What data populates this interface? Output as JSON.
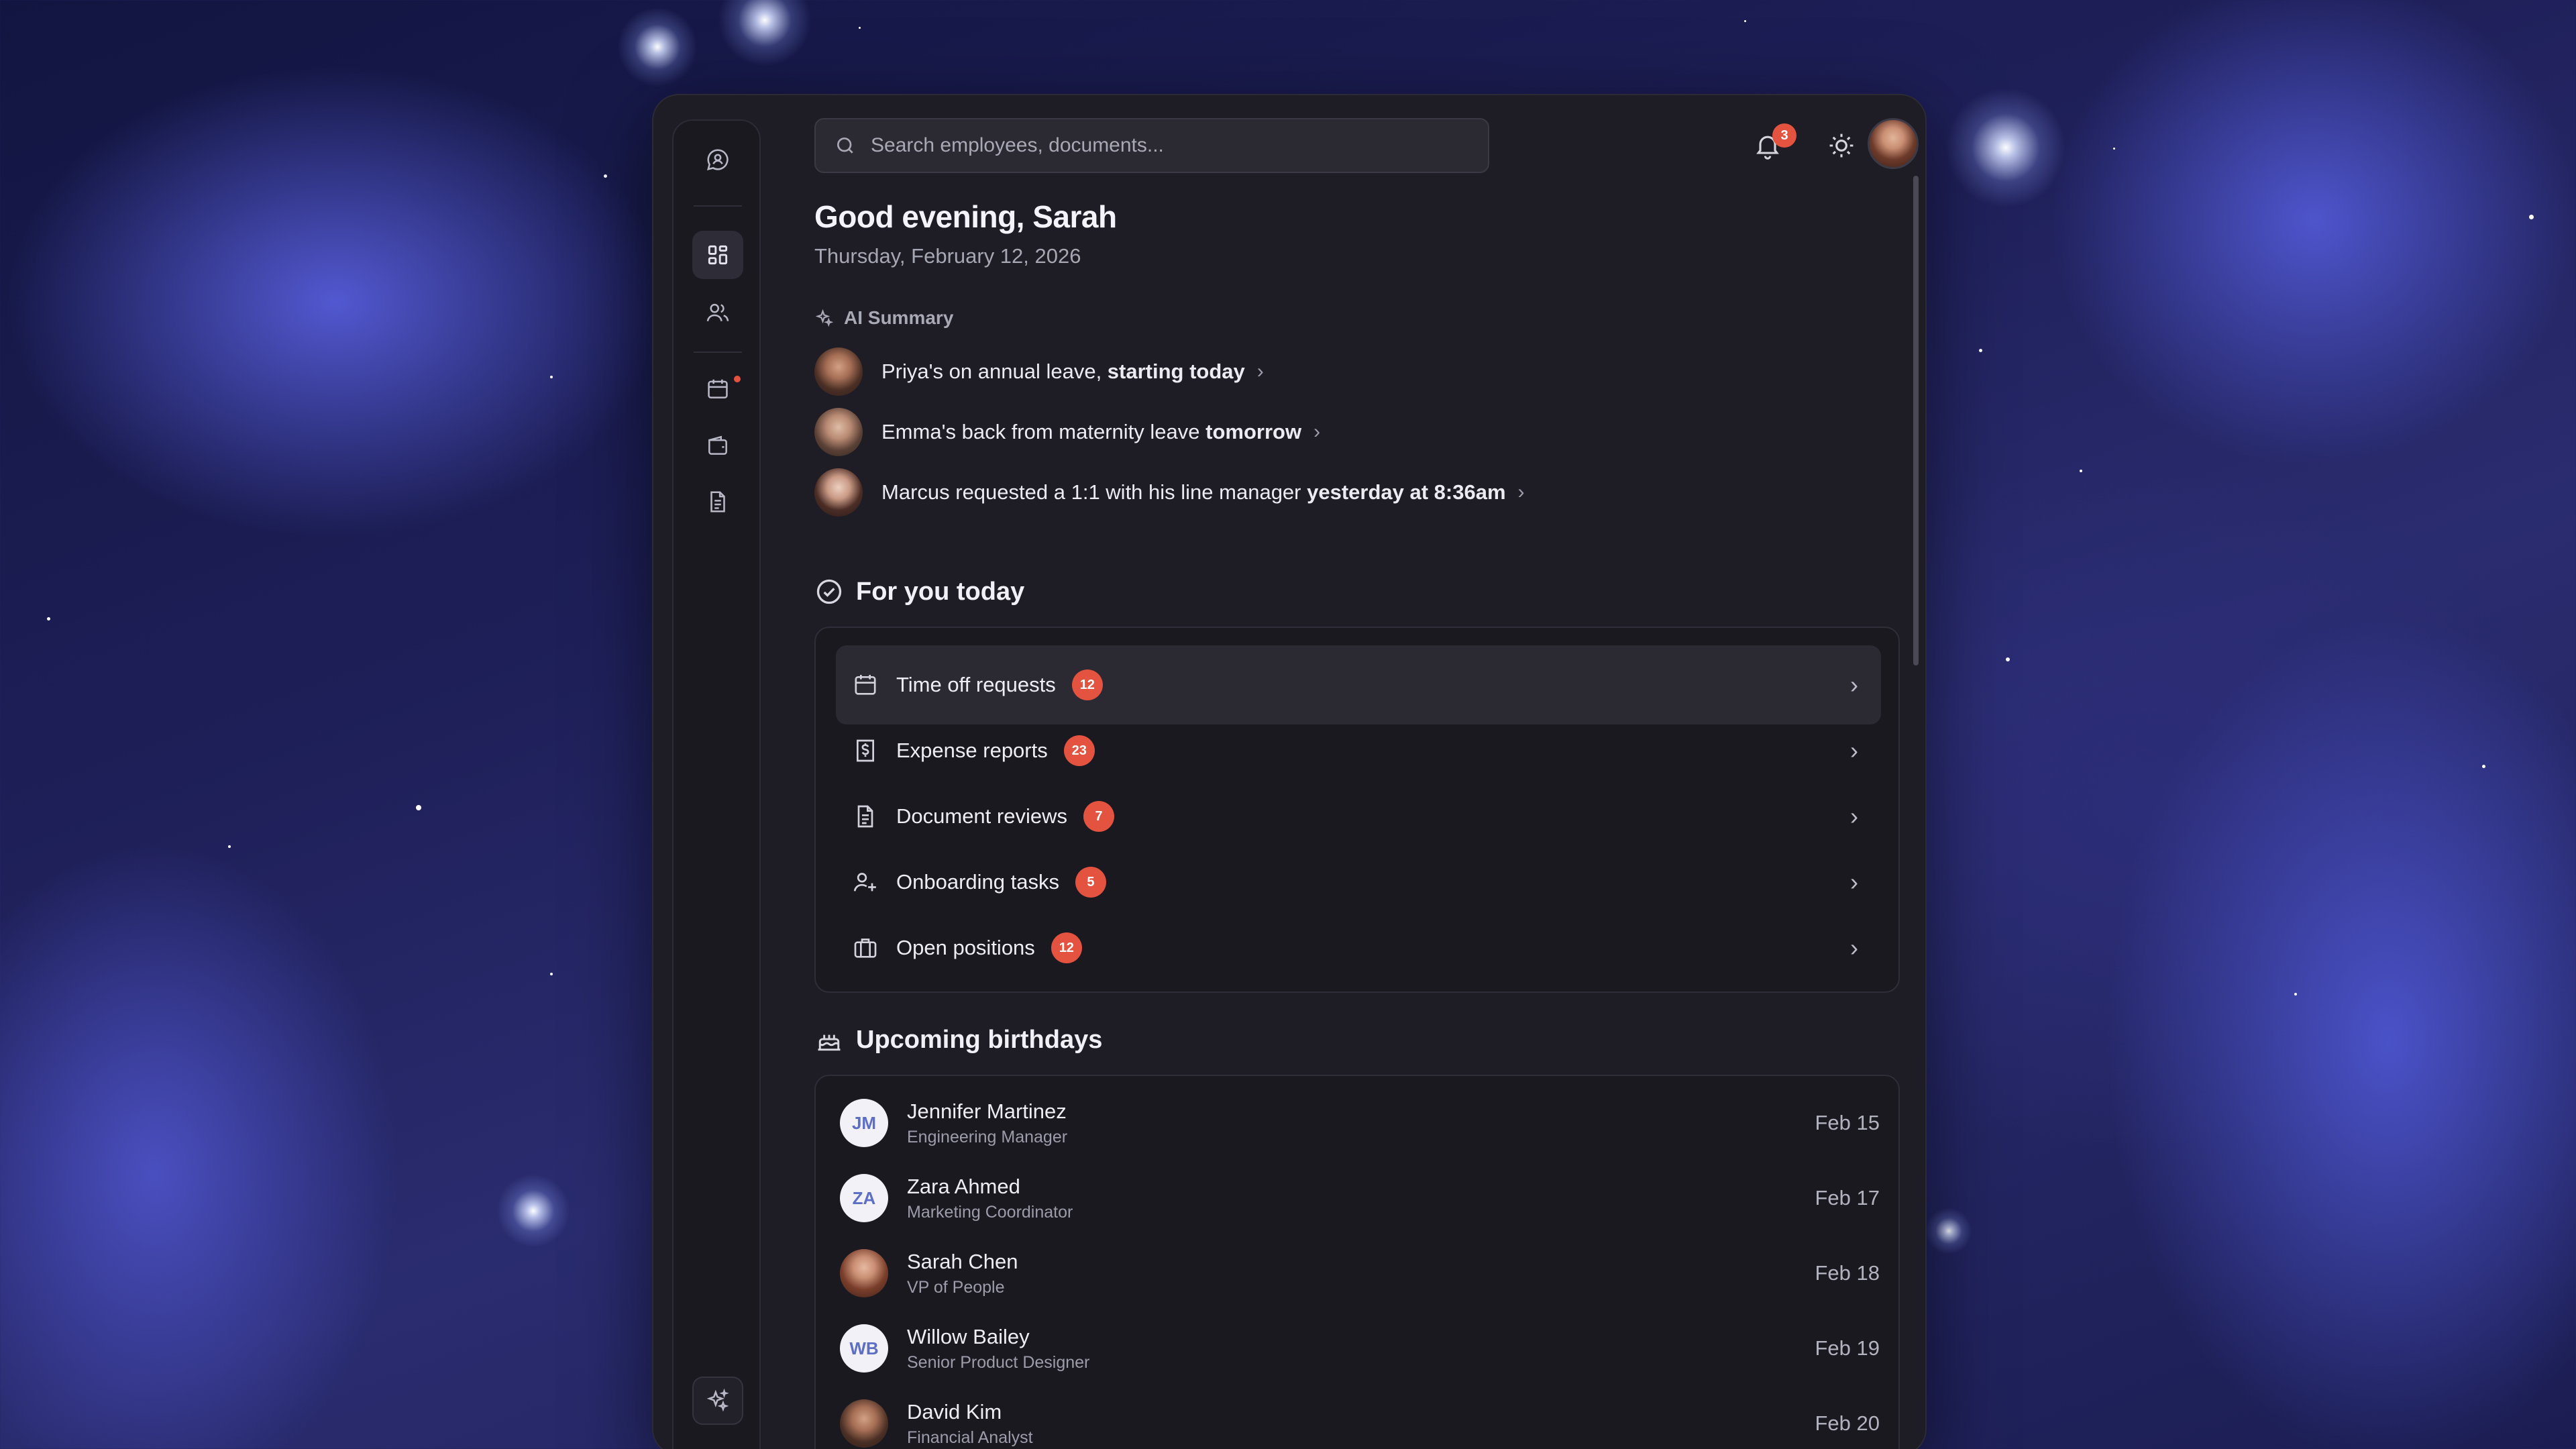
{
  "search": {
    "placeholder": "Search employees, documents..."
  },
  "header": {
    "notification_count": "3"
  },
  "greeting": {
    "title": "Good evening, Sarah",
    "date": "Thursday, February 12, 2026"
  },
  "ai_summary": {
    "label": "AI Summary",
    "items": [
      {
        "text": "Priya's on annual leave, ",
        "emphasis": "starting today"
      },
      {
        "text": "Emma's back from maternity leave ",
        "emphasis": "tomorrow"
      },
      {
        "text": "Marcus requested a 1:1 with his line manager ",
        "emphasis": "yesterday at 8:36am"
      }
    ]
  },
  "for_you": {
    "title": "For you today",
    "items": [
      {
        "label": "Time off requests",
        "count": "12",
        "icon": "calendar-icon"
      },
      {
        "label": "Expense reports",
        "count": "23",
        "icon": "receipt-icon"
      },
      {
        "label": "Document reviews",
        "count": "7",
        "icon": "document-icon"
      },
      {
        "label": "Onboarding tasks",
        "count": "5",
        "icon": "user-plus-icon"
      },
      {
        "label": "Open positions",
        "count": "12",
        "icon": "briefcase-icon"
      }
    ]
  },
  "birthdays": {
    "title": "Upcoming birthdays",
    "items": [
      {
        "initials": "JM",
        "name": "Jennifer Martinez",
        "role": "Engineering Manager",
        "date": "Feb 15"
      },
      {
        "initials": "ZA",
        "name": "Zara Ahmed",
        "role": "Marketing Coordinator",
        "date": "Feb 17"
      },
      {
        "initials": "",
        "name": "Sarah Chen",
        "role": "VP of People",
        "date": "Feb 18"
      },
      {
        "initials": "WB",
        "name": "Willow Bailey",
        "role": "Senior Product Designer",
        "date": "Feb 19"
      },
      {
        "initials": "",
        "name": "David Kim",
        "role": "Financial Analyst",
        "date": "Feb 20"
      }
    ]
  },
  "colors": {
    "accent_badge": "#e4533f",
    "panel": "#1e1d25",
    "initials_text": "#5d6fc4"
  }
}
